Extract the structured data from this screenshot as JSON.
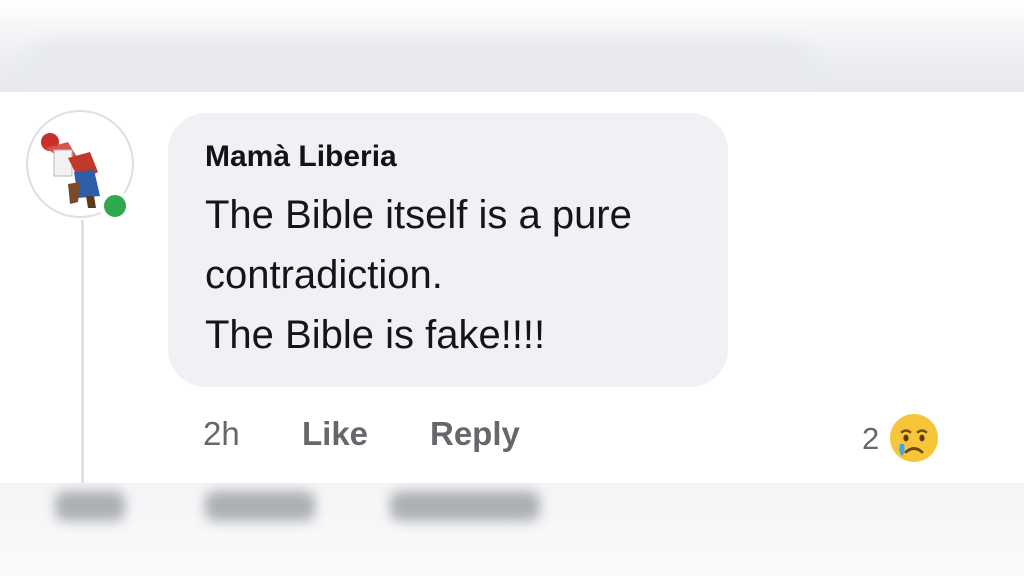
{
  "comment": {
    "author": "Mamà Liberia",
    "lines": [
      "The Bible itself is a pure",
      "contradiction.",
      "The Bible is fake!!!!"
    ],
    "time": "2h",
    "actions": {
      "like": "Like",
      "reply": "Reply"
    },
    "reaction": {
      "count": "2",
      "icon": "crying-face-icon"
    },
    "status": "online"
  },
  "colors": {
    "bubble": "#eff1f5",
    "online": "#2fa84f",
    "action_text": "#65676b"
  }
}
